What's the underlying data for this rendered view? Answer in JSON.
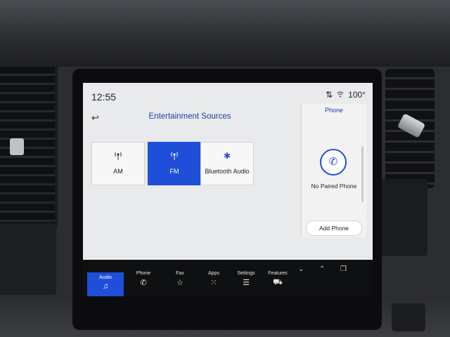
{
  "status": {
    "time": "12:55",
    "temperature": "100°"
  },
  "entertainment": {
    "title": "Entertainment Sources",
    "sources": [
      {
        "label": "AM",
        "icon": "am-antenna-icon",
        "selected": false
      },
      {
        "label": "FM",
        "icon": "fm-antenna-icon",
        "selected": true
      },
      {
        "label": "Bluetooth Audio",
        "icon": "bluetooth-icon",
        "selected": false
      }
    ]
  },
  "phone": {
    "title": "Phone",
    "status_text": "No Paired Phone",
    "add_label": "Add Phone"
  },
  "nav": {
    "items": [
      {
        "label": "Audio",
        "icon": "music-note-icon",
        "active": true
      },
      {
        "label": "Phone",
        "icon": "phone-icon",
        "active": false
      },
      {
        "label": "Fav",
        "icon": "star-icon",
        "active": false
      },
      {
        "label": "Apps",
        "icon": "grid-icon",
        "active": false
      },
      {
        "label": "Settings",
        "icon": "sliders-icon",
        "active": false
      },
      {
        "label": "Features",
        "icon": "truck-icon",
        "active": false
      }
    ]
  },
  "colors": {
    "accent": "#1f4ed8",
    "title_text": "#1a3fa8"
  }
}
